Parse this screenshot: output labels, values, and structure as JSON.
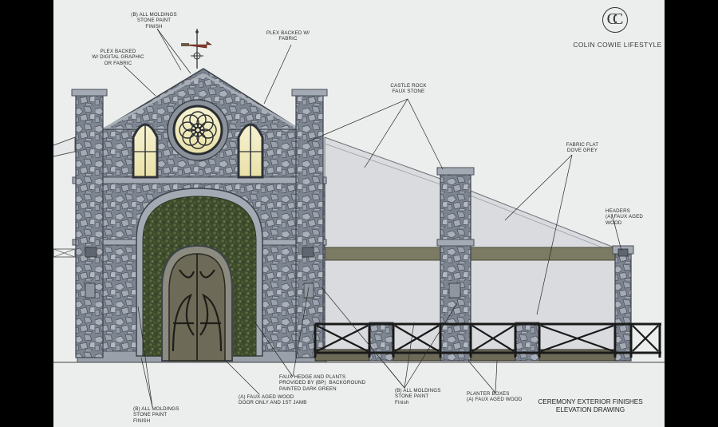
{
  "brand": {
    "monogram": "CC",
    "name": "COLIN COWIE LIFESTYLE"
  },
  "title": {
    "line1": "CEREMONY EXTERIOR FINISHES",
    "line2": "ELEVATION DRAWING"
  },
  "notes": {
    "moldings_top": "(B) ALL MOLDINGS\nSTONE PAINT\nFINISH",
    "plex_digital": "PLEX BACKED\nW/ DIGITAL GRAPHIC\nOR FABRIC",
    "plex_fabric": "PLEX BACKED W/\nFABRIC",
    "castle_rock": "CASTLE ROCK\nFAUX STONE",
    "fabric_flat": "FABRIC FLAT\nDOVE GREY",
    "headers": "HEADERS\n(A) FAUX AGED\nWOOD",
    "faux_hedge": "FAUX HEDGE AND PLANTS\nPROVIDED BY (BP)  BACKGROUND\nPAINTED DARK GREEN",
    "door": "(A) FAUX AGED WOOD\nDOOR ONLY AND 1ST JAMB",
    "moldings_bottom_left": "(B) ALL MOLDINGS\nSTONE PAINT\nFINISH",
    "moldings_bottom_mid": "(B) ALL MOLDINGS\nSTONE PAINT\nFinish",
    "planter": "PLANTER BOXES\n(A) FAUX AGED WOOD"
  },
  "colors": {
    "background": "#eceded",
    "stone": "#7f8793",
    "stone_dark": "#5c636d",
    "molding": "#9aa1aa",
    "hedge": "#3d4a2c",
    "wood": "#6e6a58",
    "header_wood": "#7b7a62",
    "window_glow": "#f3eec3",
    "fabric": "#d6d8db"
  }
}
